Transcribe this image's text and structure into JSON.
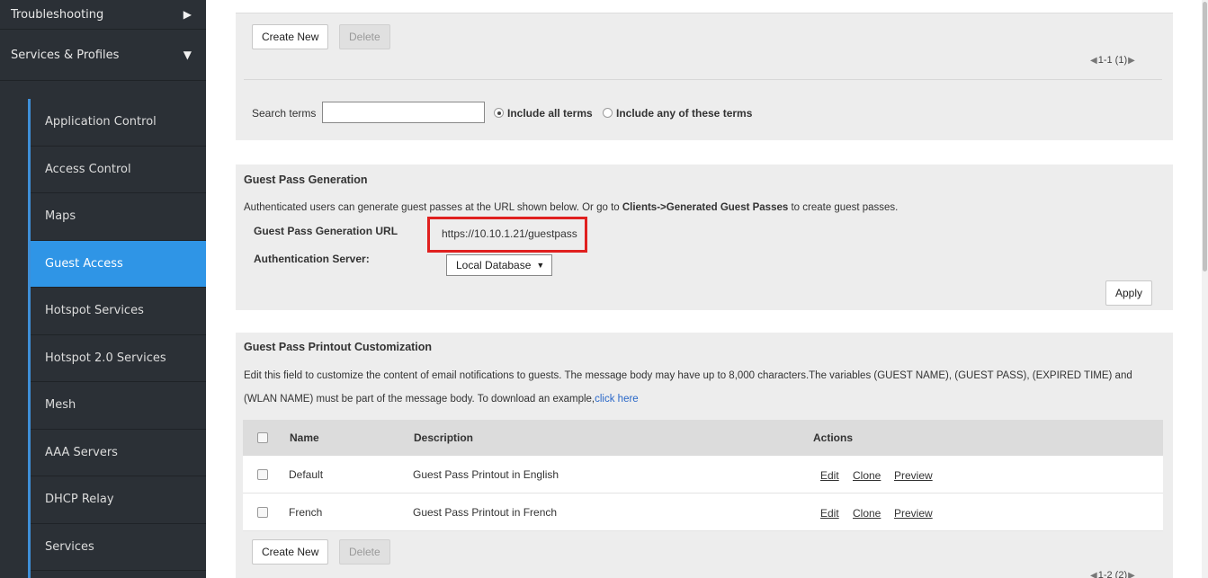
{
  "sidebar": {
    "sections": [
      {
        "label": "Troubleshooting",
        "arrow": "▶"
      },
      {
        "label": "Services & Profiles",
        "arrow": "▼"
      }
    ],
    "items": [
      {
        "label": "Application Control"
      },
      {
        "label": "Access Control"
      },
      {
        "label": "Maps"
      },
      {
        "label": "Guest Access"
      },
      {
        "label": "Hotspot Services"
      },
      {
        "label": "Hotspot 2.0 Services"
      },
      {
        "label": "Mesh"
      },
      {
        "label": "AAA Servers"
      },
      {
        "label": "DHCP Relay"
      },
      {
        "label": "Services"
      }
    ],
    "active_index": 3,
    "colors": {
      "background": "#2b3036",
      "active": "#2f95e6"
    }
  },
  "top_panel": {
    "create_label": "Create New",
    "delete_label": "Delete",
    "pager_text": "1-1 (1)",
    "search_label": "Search terms",
    "search_value": "",
    "radio_all_label": "Include all terms",
    "radio_any_label": "Include any of these terms"
  },
  "guest_pass": {
    "title": "Guest Pass Generation",
    "desc_prefix": "Authenticated users can generate guest passes at the URL shown below. Or go to ",
    "desc_bold": "Clients->Generated Guest Passes",
    "desc_suffix": " to create guest passes.",
    "url_label": "Guest Pass Generation URL",
    "url_value": "https://10.10.1.21/guestpass",
    "auth_label": "Authentication Server:",
    "auth_value": "Local Database",
    "apply_label": "Apply"
  },
  "printout": {
    "title": "Guest Pass Printout Customization",
    "desc_line1": "Edit this field to customize the content of email notifications to guests. The message body may have up to 8,000 characters.The variables (GUEST NAME), (GUEST PASS), (EXPIRED TIME) and",
    "desc_line2": "(WLAN NAME) must be part of the message body. To download an example,",
    "desc_link": "click here",
    "columns": [
      "Name",
      "Description",
      "Actions"
    ],
    "rows": [
      {
        "name": "Default",
        "description": "Guest Pass Printout in English",
        "actions": [
          "Edit",
          "Clone",
          "Preview"
        ]
      },
      {
        "name": "French",
        "description": "Guest Pass Printout in French",
        "actions": [
          "Edit",
          "Clone",
          "Preview"
        ]
      }
    ],
    "create_label": "Create New",
    "delete_label": "Delete",
    "pager_text": "1-2 (2)"
  },
  "highlight_color": "#e0201f"
}
